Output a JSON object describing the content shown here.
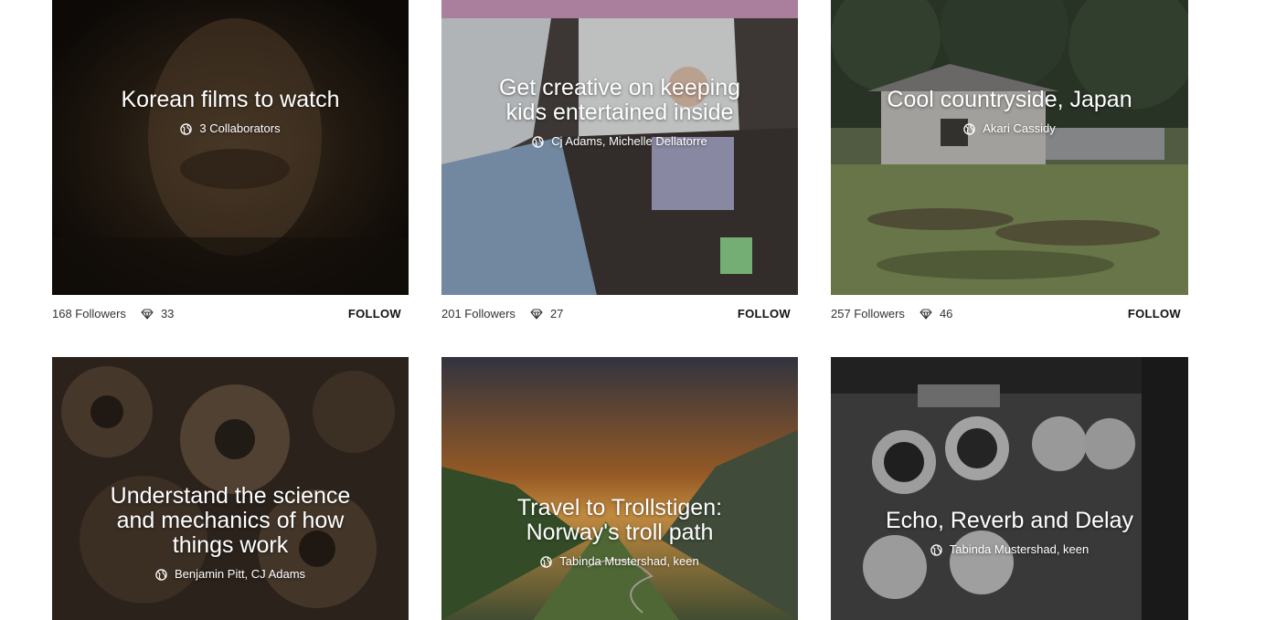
{
  "cards": [
    {
      "title": "Korean films to watch",
      "authors": "3 Collaborators",
      "followers": "168 Followers",
      "likes": "33",
      "follow_label": "FOLLOW",
      "image_icon": "portrait-photo"
    },
    {
      "title": "Get creative on keeping kids entertained inside",
      "authors": "Cj Adams, Michelle Dellatorre",
      "followers": "201 Followers",
      "likes": "27",
      "follow_label": "FOLLOW",
      "image_icon": "child-under-blanket-photo"
    },
    {
      "title": "Cool countryside, Japan",
      "authors": "Akari Cassidy",
      "followers": "257 Followers",
      "likes": "46",
      "follow_label": "FOLLOW",
      "image_icon": "countryside-house-photo"
    },
    {
      "title": "Understand the science and mechanics of how things work",
      "authors": "Benjamin Pitt, CJ Adams",
      "image_icon": "gears-photo"
    },
    {
      "title": "Travel to Trollstigen: Norway's troll path",
      "authors": "Tabinda Mustershad, keen",
      "image_icon": "mountain-road-photo"
    },
    {
      "title": "Echo, Reverb and Delay",
      "authors": "Tabinda Mustershad, keen",
      "image_icon": "audio-knobs-photo"
    }
  ],
  "colors": {
    "background": "#ffffff",
    "overlay_text": "#ffffff",
    "meta_text": "#333333"
  }
}
